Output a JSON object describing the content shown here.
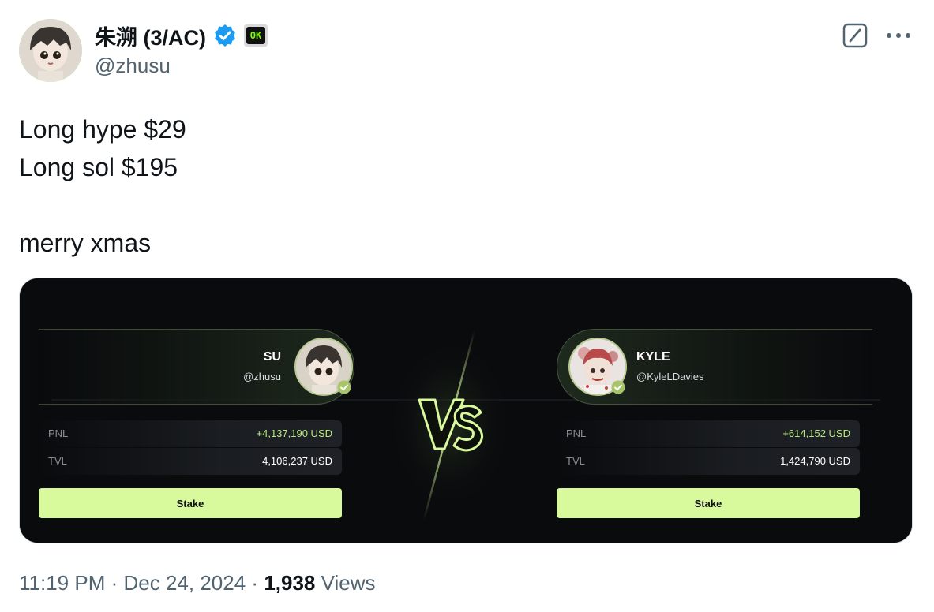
{
  "author": {
    "display_name": "朱溯 (3/AC)",
    "handle": "@zhusu",
    "verified_icon": "verified-badge-icon",
    "affiliate_badge_text": "OK"
  },
  "tweet": {
    "lines": [
      "Long hype $29",
      "Long sol $195",
      "",
      "merry xmas"
    ]
  },
  "media": {
    "left_player": {
      "name": "SU",
      "handle": "@zhusu",
      "pnl_label": "PNL",
      "pnl_value": "+4,137,190 USD",
      "tvl_label": "TVL",
      "tvl_value": "4,106,237 USD",
      "stake_label": "Stake"
    },
    "right_player": {
      "name": "KYLE",
      "handle": "@KyleLDavies",
      "pnl_label": "PNL",
      "pnl_value": "+614,152 USD",
      "tvl_label": "TVL",
      "tvl_value": "1,424,790 USD",
      "stake_label": "Stake"
    },
    "vs_text": "VS",
    "colors": {
      "accent": "#d9f99d",
      "positive": "#b8e986",
      "card_bg": "#090b0d"
    }
  },
  "footer": {
    "time": "11:19 PM",
    "date": "Dec 24, 2024",
    "sep": "·",
    "views_count": "1,938",
    "views_label": "Views"
  }
}
